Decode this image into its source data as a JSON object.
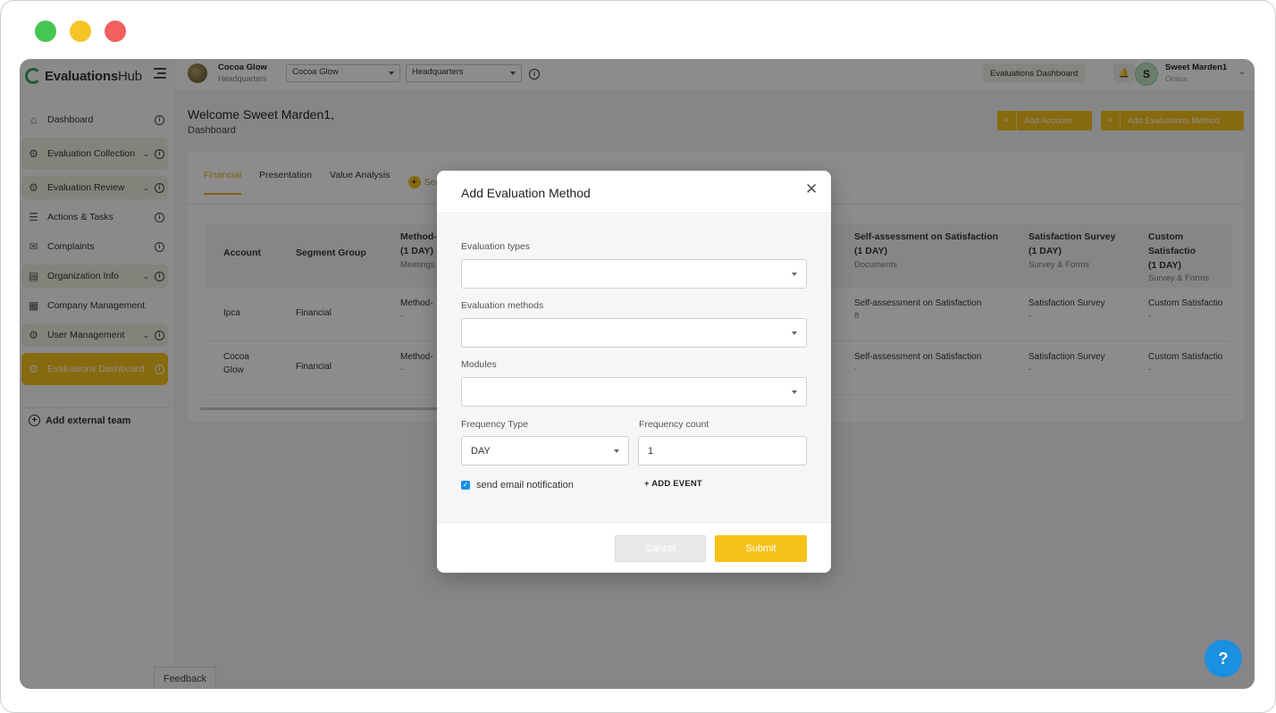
{
  "window": {
    "controls": [
      "close",
      "minimize",
      "maximize"
    ]
  },
  "sidebar": {
    "brand": {
      "bold": "Evaluations",
      "light": "Hub"
    },
    "items": [
      {
        "label": "Dashboard",
        "icon": "home-icon"
      },
      {
        "label": "Evaluation Collection",
        "icon": "search-gear-icon",
        "expandable": true
      },
      {
        "label": "Evaluation Review",
        "icon": "gear-icon",
        "expandable": true
      },
      {
        "label": "Actions & Tasks",
        "icon": "tasks-icon"
      },
      {
        "label": "Complaints",
        "icon": "complaint-icon"
      },
      {
        "label": "Organization Info",
        "icon": "chart-icon",
        "expandable": true
      },
      {
        "label": "Company Management",
        "icon": "building-icon"
      },
      {
        "label": "User Management",
        "icon": "gear-icon",
        "expandable": true
      },
      {
        "label": "Evaluations Dashboard",
        "icon": "dashboard-icon",
        "active": true
      }
    ],
    "add_external": "Add external team",
    "feedback": "Feedback"
  },
  "topbar": {
    "org_name": "Cocoa Glow",
    "org_sub": "Headquarters",
    "select_company": "Cocoa Glow",
    "select_location": "Headquarters",
    "dashboard_button": "Evaluations Dashboard",
    "user_initial": "S",
    "user_name": "Sweet Marden1",
    "user_sub": "Onson"
  },
  "main": {
    "welcome": "Welcome Sweet Marden1,",
    "breadcrumb": "Dashboard",
    "add_account": "Add Account",
    "add_method": "Add Evaluations Method",
    "tabs": [
      "Financial",
      "Presentation",
      "Value Analysis"
    ],
    "tab_add": "Seg",
    "table": {
      "headers": [
        {
          "title": "Account"
        },
        {
          "title": "Segment Group"
        },
        {
          "title": "Method-",
          "line2": "(1 DAY)",
          "sub": "Meetings"
        },
        {
          "title": "Self-assessment on Satisfaction",
          "line2": "(1 DAY)",
          "sub": "Documents"
        },
        {
          "title": "Satisfaction Survey",
          "line2": "(1 DAY)",
          "sub": "Survey & Forms"
        },
        {
          "title": "Custom Satisfactio",
          "line2": "(1 DAY)",
          "sub": "Survey & Forms"
        }
      ],
      "rows": [
        {
          "account": "Ipca",
          "segment": "Financial",
          "method": "Method-",
          "method_sub": "-",
          "self": "Self-assessment on Satisfaction",
          "self_sub": "8",
          "survey": "Satisfaction Survey",
          "survey_sub": "-",
          "custom": "Custom Satisfactio",
          "custom_sub": "-"
        },
        {
          "account": "Cocoa Glow",
          "segment": "Financial",
          "method": "Method-",
          "method_sub": "-",
          "self": "Self-assessment on Satisfaction",
          "self_sub": "-",
          "survey": "Satisfaction Survey",
          "survey_sub": "-",
          "custom": "Custom Satisfactio",
          "custom_sub": "-"
        }
      ]
    }
  },
  "modal": {
    "title": "Add Evaluation Method",
    "evaluation_types_label": "Evaluation types",
    "evaluation_types_value": "",
    "evaluation_methods_label": "Evaluation methods",
    "evaluation_methods_value": "",
    "modules_label": "Modules",
    "modules_value": "",
    "frequency_type_label": "Frequency Type",
    "frequency_type_value": "DAY",
    "frequency_count_label": "Frequency count",
    "frequency_count_value": "1",
    "send_email_label": "send email notification",
    "send_email_checked": true,
    "add_event": "+ ADD EVENT",
    "cancel": "Cancel",
    "submit": "Submit"
  },
  "help": "?",
  "colors": {
    "accent": "#f6c21a",
    "link": "#1b8fe0",
    "brand_green": "#3aa65a"
  }
}
